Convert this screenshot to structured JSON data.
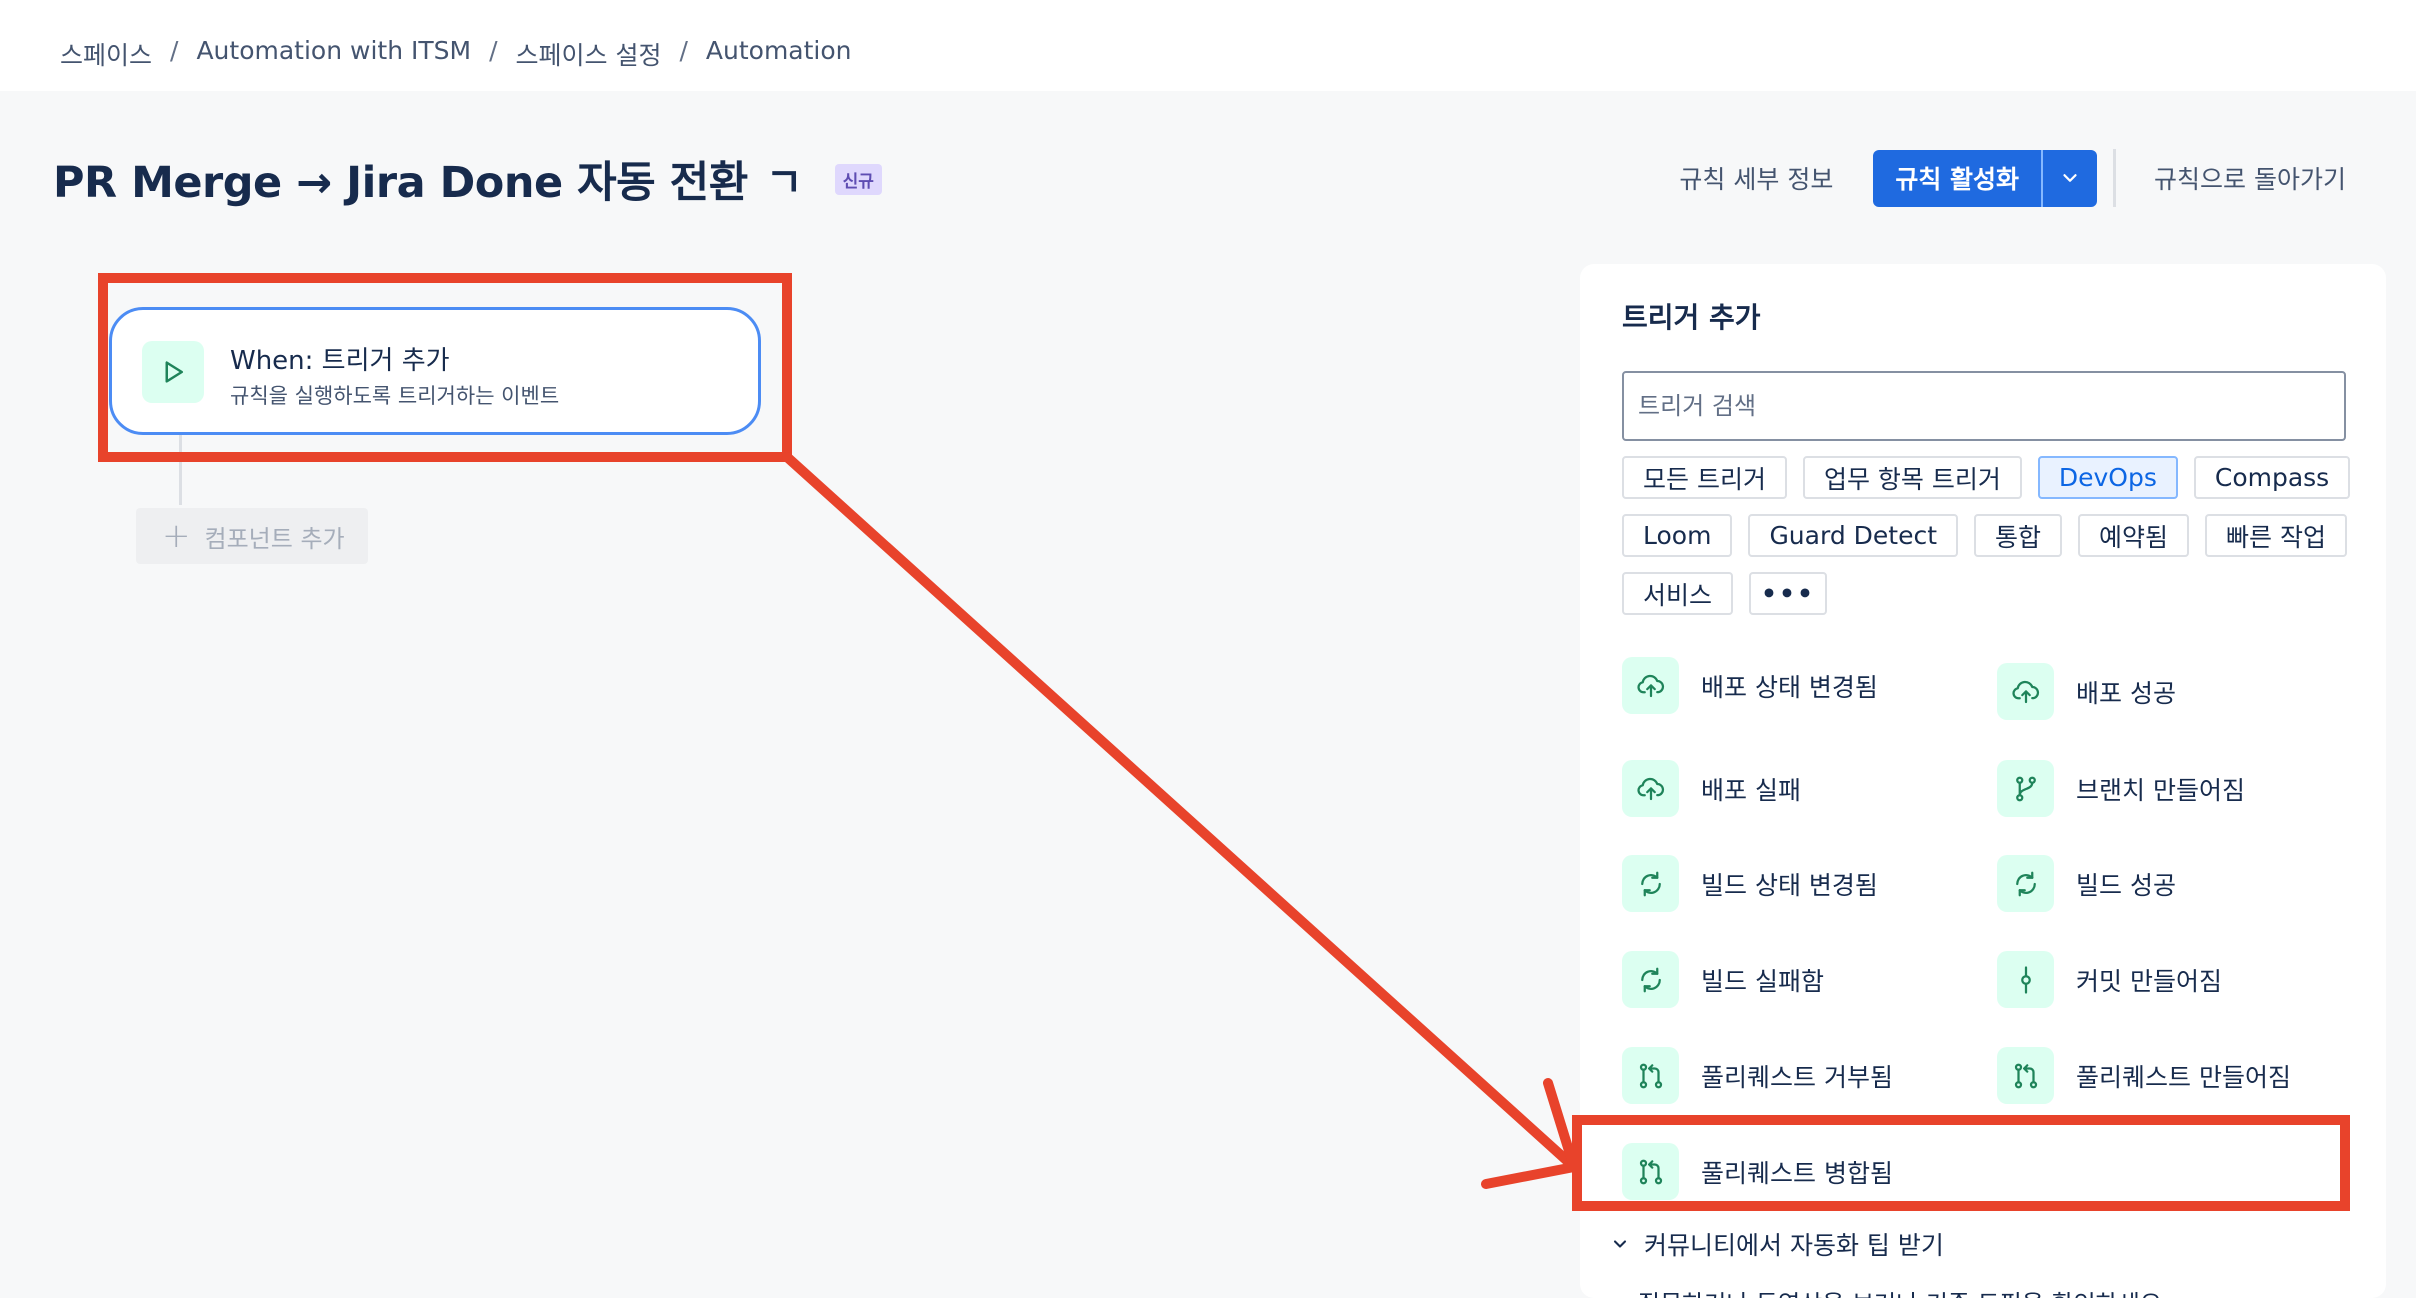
{
  "breadcrumb": [
    "스페이스",
    "Automation with ITSM",
    "스페이스 설정",
    "Automation"
  ],
  "header": {
    "title": "PR Merge → Jira Done 자동 전환",
    "badge": "신규",
    "rule_details": "규칙 세부 정보",
    "activate": "규칙 활성화",
    "back": "규칙으로 돌아가기"
  },
  "canvas": {
    "node_title": "When: 트리거 추가",
    "node_subtitle": "규칙을 실행하도록 트리거하는 이벤트",
    "add_component": "컴포넌트 추가"
  },
  "panel": {
    "title": "트리거 추가",
    "search_placeholder": "트리거 검색",
    "chips": [
      "모든 트리거",
      "업무 항목 트리거",
      "DevOps",
      "Compass",
      "Loom",
      "Guard Detect",
      "통합",
      "예약됨",
      "빠른 작업",
      "서비스"
    ],
    "active_chip": "DevOps",
    "triggers": [
      {
        "label": "배포 상태 변경됨",
        "icon": "cloud-upload-icon"
      },
      {
        "label": "배포 성공",
        "icon": "cloud-upload-icon"
      },
      {
        "label": "배포 실패",
        "icon": "cloud-upload-icon"
      },
      {
        "label": "브랜치 만들어짐",
        "icon": "branch-icon"
      },
      {
        "label": "빌드 상태 변경됨",
        "icon": "refresh-icon"
      },
      {
        "label": "빌드 성공",
        "icon": "refresh-icon"
      },
      {
        "label": "빌드 실패함",
        "icon": "refresh-icon"
      },
      {
        "label": "커밋 만들어짐",
        "icon": "commit-icon"
      },
      {
        "label": "풀리퀘스트 거부됨",
        "icon": "pull-request-icon"
      },
      {
        "label": "풀리퀘스트 만들어짐",
        "icon": "pull-request-icon"
      },
      {
        "label": "풀리퀘스트 병합됨",
        "icon": "pull-request-icon"
      }
    ],
    "community": "커뮤니티에서 자동화 팁 받기",
    "community_sub": "질문하거나 동영상을 보거나 기존 토픽을 확인하세요"
  },
  "colors": {
    "primary": "#1f6ae0",
    "annotation": "#e8432b",
    "icon_bg": "#dcfff1",
    "icon_fg": "#1f845a",
    "node_border": "#4c8cf4"
  }
}
